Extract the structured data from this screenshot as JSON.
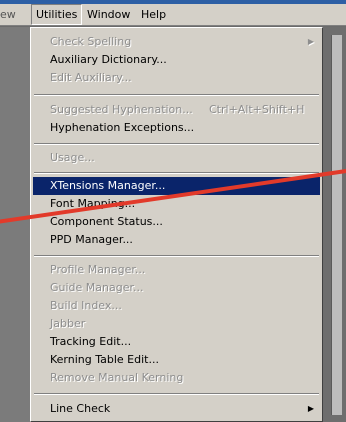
{
  "menubar": {
    "partial_item": "ew",
    "utilities": "Utilities",
    "window": "Window",
    "help": "Help"
  },
  "menu": {
    "check_spelling": "Check Spelling",
    "auxiliary_dictionary": "Auxiliary Dictionary...",
    "edit_auxiliary": "Edit Auxiliary...",
    "suggested_hyphenation": "Suggested Hyphenation...",
    "suggested_hyphenation_shortcut": "Ctrl+Alt+Shift+H",
    "hyphenation_exceptions": "Hyphenation Exceptions...",
    "usage": "Usage...",
    "xtensions_manager": "XTensions Manager...",
    "font_mapping": "Font Mapping...",
    "component_status": "Component Status...",
    "ppd_manager": "PPD Manager...",
    "profile_manager": "Profile Manager...",
    "guide_manager": "Guide Manager...",
    "build_index": "Build Index...",
    "jabber": "Jabber",
    "tracking_edit": "Tracking Edit...",
    "kerning_table_edit": "Kerning Table Edit...",
    "remove_manual_kerning": "Remove Manual Kerning",
    "line_check": "Line Check"
  },
  "colors": {
    "selection": "#0a246a",
    "menu_bg": "#d4d0c8",
    "annotation_line": "#e23a2a"
  },
  "icons": {
    "submenu": "submenu-arrow-icon"
  }
}
